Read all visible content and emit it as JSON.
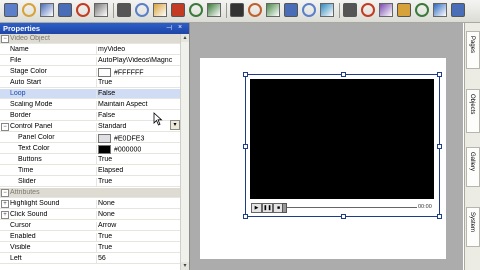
{
  "toolbar": {
    "icons": [
      "document-icon",
      "open-icon",
      "save-icon",
      "save-all-icon",
      "mail-icon",
      "link-icon",
      "cut-icon",
      "copy-icon",
      "paste-icon",
      "delete-icon",
      "undo-icon",
      "redo-icon",
      "text-icon",
      "paint-icon",
      "image-icon",
      "play-icon",
      "page-icon",
      "globe-icon",
      "pointer-icon",
      "record-icon",
      "palette-icon",
      "folder-icon",
      "chart-icon",
      "publish-icon",
      "help-icon"
    ]
  },
  "properties": {
    "title": "Properties",
    "rows": [
      {
        "kind": "cat",
        "name": "Video Object",
        "expander": "−"
      },
      {
        "kind": "prop",
        "name": "Name",
        "value": "myVideo"
      },
      {
        "kind": "prop",
        "name": "File",
        "value": "AutoPlay\\Videos\\Magnc"
      },
      {
        "kind": "prop",
        "name": "Stage Color",
        "value": "#FFFFFF",
        "swatch": "#FFFFFF"
      },
      {
        "kind": "prop",
        "name": "Auto Start",
        "value": "True"
      },
      {
        "kind": "prop",
        "name": "Loop",
        "value": "False",
        "selected": true
      },
      {
        "kind": "prop",
        "name": "Scaling Mode",
        "value": "Maintain Aspect"
      },
      {
        "kind": "prop",
        "name": "Border",
        "value": "False"
      },
      {
        "kind": "prop",
        "name": "Control Panel",
        "value": "Standard",
        "expander": "−"
      },
      {
        "kind": "child",
        "name": "Panel Color",
        "value": "#E0DFE3",
        "swatch": "#E0DFE3"
      },
      {
        "kind": "child",
        "name": "Text Color",
        "value": "#000000",
        "swatch": "#000000"
      },
      {
        "kind": "child",
        "name": "Buttons",
        "value": "True"
      },
      {
        "kind": "child",
        "name": "Time",
        "value": "Elapsed"
      },
      {
        "kind": "child",
        "name": "Slider",
        "value": "True"
      },
      {
        "kind": "cat",
        "name": "Attributes",
        "expander": "−"
      },
      {
        "kind": "prop",
        "name": "Highlight Sound",
        "value": "None",
        "expander": "+"
      },
      {
        "kind": "prop",
        "name": "Click Sound",
        "value": "None",
        "expander": "+"
      },
      {
        "kind": "prop",
        "name": "Cursor",
        "value": "Arrow"
      },
      {
        "kind": "prop",
        "name": "Enabled",
        "value": "True"
      },
      {
        "kind": "prop",
        "name": "Visible",
        "value": "True"
      },
      {
        "kind": "prop",
        "name": "Left",
        "value": "56"
      }
    ]
  },
  "video": {
    "elapsed": "00:00"
  },
  "dock": {
    "tabs": [
      "Pages",
      "Objects",
      "Gallery",
      "System"
    ]
  }
}
